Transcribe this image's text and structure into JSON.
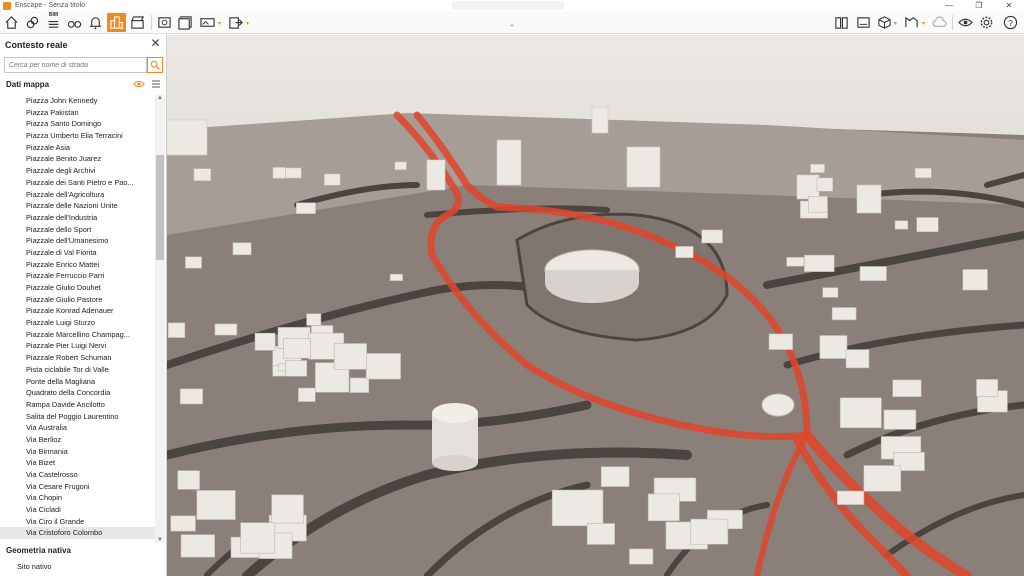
{
  "window": {
    "title": "Enscape - Senza titolo",
    "controls": [
      "—",
      "❐",
      "✕"
    ]
  },
  "toolbar": {
    "bim_badge": "BIM",
    "icons": {
      "home": "home-icon",
      "link": "link-icon",
      "bim": "bim-icon",
      "binoculars": "binoculars-icon",
      "bell": "bell-icon",
      "site": "site-context-icon",
      "clapper": "clapperboard-icon",
      "screenshot": "screenshot-icon",
      "batch": "batch-render-icon",
      "pano": "panorama-icon",
      "export": "export-icon",
      "asset": "asset-library-icon",
      "camera": "camera-icon",
      "cube": "cube-icon",
      "material": "material-icon",
      "cloud": "cloud-icon",
      "eye": "eye-icon",
      "gear": "gear-icon",
      "help": "help-icon"
    }
  },
  "panel": {
    "title": "Contesto reale",
    "search_placeholder": "Cerca per nome di strada",
    "section_map": "Dati mappa",
    "streets": [
      "Piazza John Kennedy",
      "Piazza Pakistan",
      "Piazza Santo Domingo",
      "Piazza Umberto Elia Terracini",
      "Piazzale Asia",
      "Piazzale Benito Juarez",
      "Piazzale degli Archivi",
      "Piazzale dei Santi Pietro e Pao...",
      "Piazzale dell'Agricoltura",
      "Piazzale delle Nazioni Unite",
      "Piazzale dell'Industria",
      "Piazzale dello Sport",
      "Piazzale dell'Umanesimo",
      "Piazzale di Val Fiorita",
      "Piazzale Enrico Mattei",
      "Piazzale Ferruccio Parri",
      "Piazzale Giulio Douhet",
      "Piazzale Giulio Pastore",
      "Piazzale Konrad Adenauer",
      "Piazzale Luigi Sturzo",
      "Piazzale Marcellino Champag...",
      "Piazzale Pier Luigi Nervi",
      "Piazzale Robert Schuman",
      "Pista ciclabile Tor di Valle",
      "Ponte della Magliana",
      "Quadrato della Concordia",
      "Rampa Davide Ancilotto",
      "Salita del Poggio Laurentino",
      "Via Australia",
      "Via Berlioz",
      "Via Birmania",
      "Via Bizet",
      "Via Castelrosso",
      "Via Cesare Frugoni",
      "Via Chopin",
      "Via Cicladi",
      "Via Ciro il Grande",
      "Via Cristoforo Colombo"
    ],
    "selected_street": "Via Cristoforo Colombo",
    "section_geometry": "Geometria nativa",
    "geometry_item": "Sito nativo"
  },
  "colors": {
    "accent": "#f08a1c",
    "highlight_road": "#e0452b",
    "ground": "#8a8079",
    "road": "#4a4541",
    "building": "#ece9e5",
    "sky": "#ece9e6"
  }
}
